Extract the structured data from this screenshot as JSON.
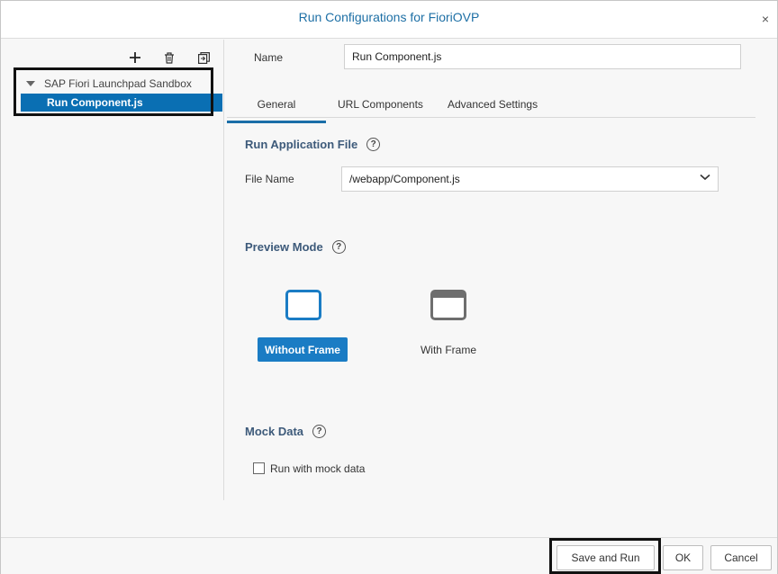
{
  "dialog": {
    "title": "Run Configurations for FioriOVP",
    "close_glyph": "×"
  },
  "toolbar": {
    "add_icon": "plus-icon",
    "delete_icon": "trash-icon",
    "copy_icon": "duplicate-icon"
  },
  "tree": {
    "parent_label": "SAP Fiori Launchpad Sandbox",
    "child_label": "Run Component.js"
  },
  "form": {
    "name_label": "Name",
    "name_value": "Run Component.js"
  },
  "tabs": {
    "general": "General",
    "url_components": "URL Components",
    "advanced": "Advanced Settings"
  },
  "run_application": {
    "heading": "Run Application File",
    "file_label": "File Name",
    "file_value": "/webapp/Component.js"
  },
  "preview_mode": {
    "heading": "Preview Mode",
    "without_frame": "Without Frame",
    "with_frame": "With Frame",
    "selected": "Without Frame"
  },
  "mock_data": {
    "heading": "Mock Data",
    "checkbox_label": "Run with mock data",
    "checked": false
  },
  "help_glyph": "?",
  "footer": {
    "save_run": "Save and Run",
    "ok": "OK",
    "cancel": "Cancel"
  },
  "colors": {
    "accent": "#0a6fb3",
    "heading": "#3d5a7a",
    "title": "#1d6fa5"
  }
}
